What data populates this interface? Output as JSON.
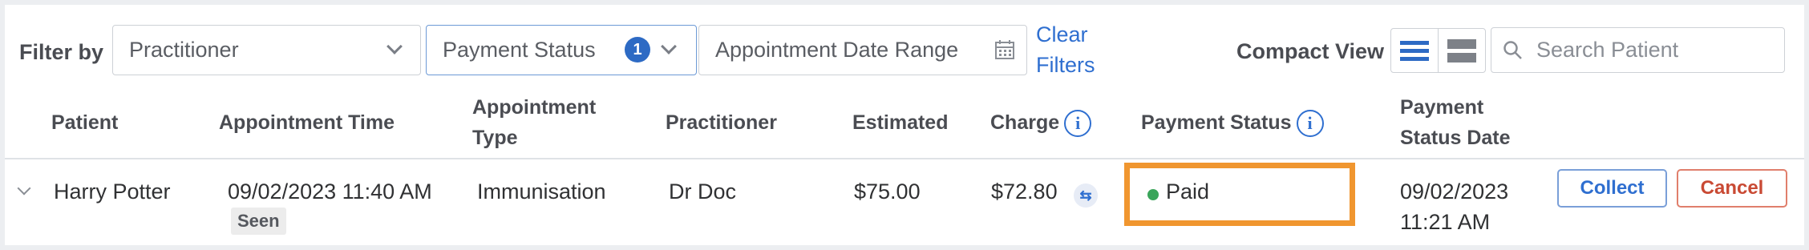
{
  "filters": {
    "label": "Filter by",
    "practitioner_placeholder": "Practitioner",
    "payment_status_label": "Payment Status",
    "payment_status_count": "1",
    "date_range_placeholder": "Appointment Date Range",
    "clear_filters_line1": "Clear",
    "clear_filters_line2": "Filters",
    "compact_view_label": "Compact View",
    "search_placeholder": "Search Patient"
  },
  "table": {
    "headers": {
      "patient": "Patient",
      "appointment_time": "Appointment Time",
      "appointment_type_line1": "Appointment",
      "appointment_type_line2": "Type",
      "practitioner": "Practitioner",
      "estimated": "Estimated",
      "charge": "Charge",
      "payment_status": "Payment Status",
      "payment_status_date_line1": "Payment",
      "payment_status_date_line2": "Status Date"
    },
    "rows": [
      {
        "patient": "Harry Potter",
        "appointment_time": "09/02/2023 11:40 AM",
        "status_tag": "Seen",
        "appointment_type": "Immunisation",
        "practitioner": "Dr Doc",
        "estimated": "$75.00",
        "charge": "$72.80",
        "payment_status": "Paid",
        "payment_status_date_line1": "09/02/2023",
        "payment_status_date_line2": "11:21 AM",
        "collect_label": "Collect",
        "cancel_label": "Cancel"
      }
    ]
  },
  "icons": {
    "calendar": "calendar-icon",
    "search": "search-icon",
    "info": "info-icon",
    "swap": "swap-icon",
    "list_view": "list-view-icon",
    "compact_view": "compact-view-icon"
  },
  "colors": {
    "accent": "#2d6ac4",
    "highlight": "#f0962f",
    "paid_dot": "#3aa55a",
    "cancel": "#c94a34"
  }
}
